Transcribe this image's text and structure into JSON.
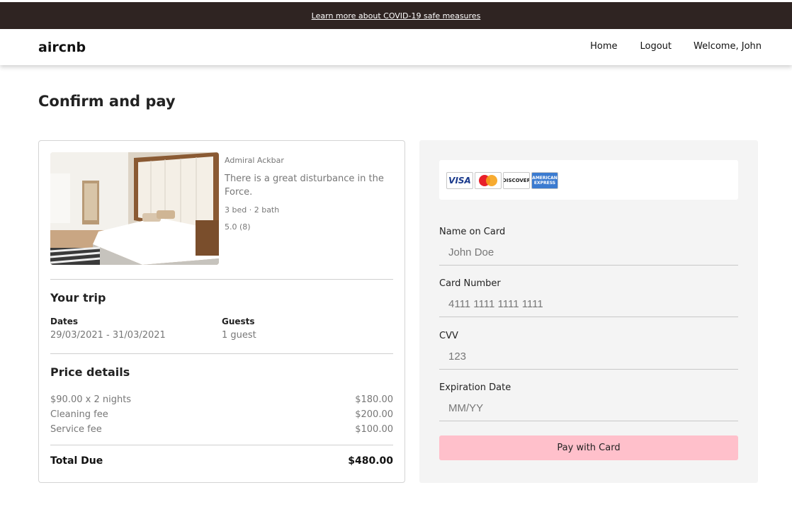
{
  "banner": {
    "link_text": "Learn more about COVID-19 safe measures"
  },
  "header": {
    "logo": "aircnb",
    "nav": {
      "home": "Home",
      "logout": "Logout",
      "welcome": "Welcome, John"
    }
  },
  "page": {
    "title": "Confirm and pay"
  },
  "listing": {
    "host": "Admiral Ackbar",
    "description": "There is a great disturbance in the Force.",
    "beds_baths": "3 bed · 2 bath",
    "rating": "5.0 (8)"
  },
  "trip": {
    "heading": "Your trip",
    "dates_label": "Dates",
    "dates_value": "29/03/2021 - 31/03/2021",
    "guests_label": "Guests",
    "guests_value": "1 guest"
  },
  "price": {
    "heading": "Price details",
    "rows": [
      {
        "label": "$90.00 x 2 nights",
        "amount": "$180.00"
      },
      {
        "label": "Cleaning fee",
        "amount": "$200.00"
      },
      {
        "label": "Service fee",
        "amount": "$100.00"
      }
    ],
    "total_label": "Total Due",
    "total_amount": "$480.00"
  },
  "payment": {
    "card_brands": [
      "VISA",
      "MasterCard",
      "DISCOVER",
      "AMERICAN EXPRESS"
    ],
    "name_label": "Name on Card",
    "name_placeholder": "John Doe",
    "number_label": "Card Number",
    "number_placeholder": "4111 1111 1111 1111",
    "cvv_label": "CVV",
    "cvv_placeholder": "123",
    "exp_label": "Expiration Date",
    "exp_placeholder": "MM/YY",
    "pay_button": "Pay with Card"
  },
  "colors": {
    "banner_bg": "#2f2422",
    "pay_button_bg": "#ffc0cb",
    "panel_bg": "#f4f4f4"
  }
}
